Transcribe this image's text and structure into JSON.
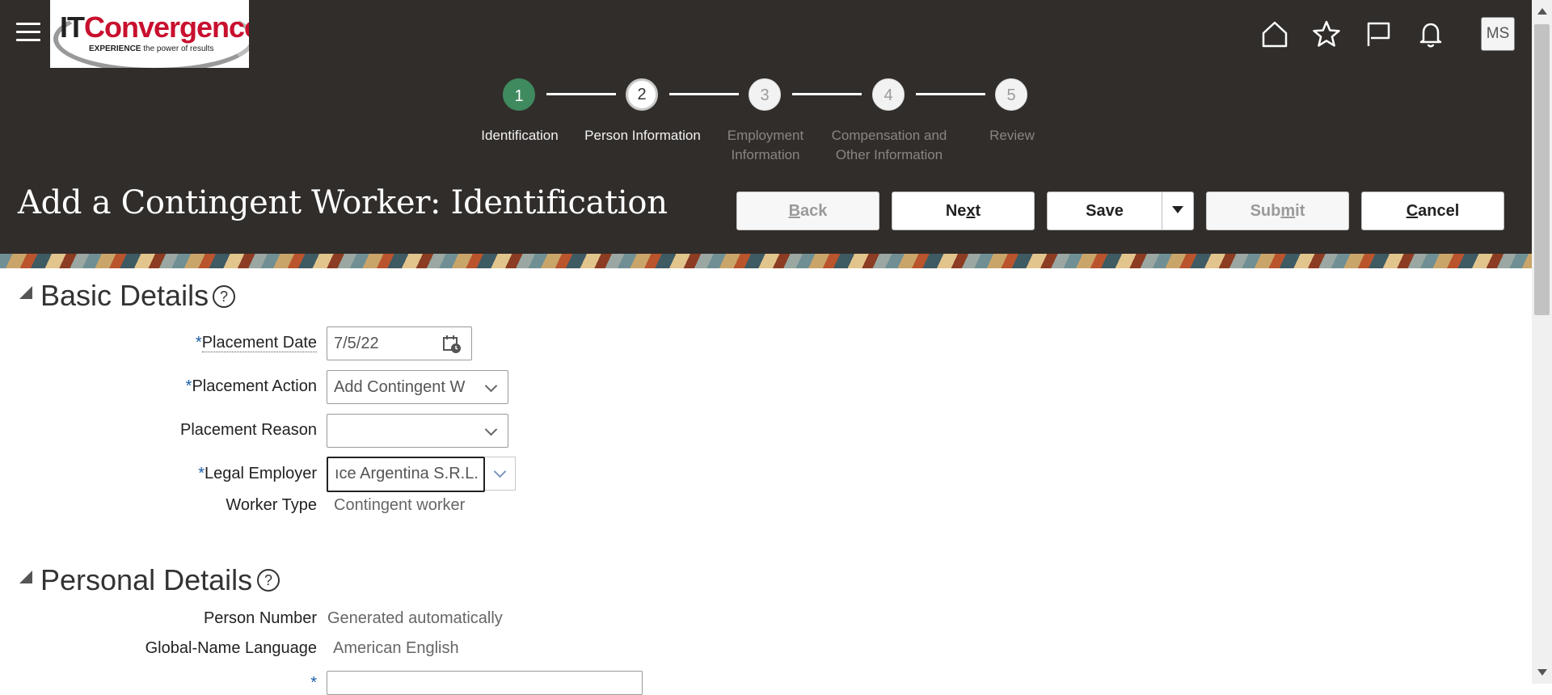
{
  "header": {
    "logo": {
      "it": "IT",
      "convergence": "Convergence",
      "tagline_bold": "EXPERIENCE",
      "tagline_rest": " the power of results"
    },
    "user_initials": "MS",
    "icons": [
      "menu-icon",
      "home-icon",
      "star-icon",
      "flag-icon",
      "bell-icon"
    ]
  },
  "train": {
    "steps": [
      {
        "number": "1",
        "label": "Identification",
        "state": "done"
      },
      {
        "number": "2",
        "label": "Person Information",
        "state": "current"
      },
      {
        "number": "3",
        "label": "Employment\nInformation",
        "state": "future"
      },
      {
        "number": "4",
        "label": "Compensation and\nOther Information",
        "state": "future"
      },
      {
        "number": "5",
        "label": "Review",
        "state": "future"
      }
    ]
  },
  "page": {
    "title": "Add a Contingent Worker: Identification",
    "buttons": {
      "back": {
        "pre": "",
        "key": "B",
        "post": "ack"
      },
      "next": {
        "pre": "Ne",
        "key": "x",
        "post": "t"
      },
      "save": "Save",
      "submit": {
        "pre": "Sub",
        "key": "m",
        "post": "it"
      },
      "cancel": {
        "pre": "",
        "key": "C",
        "post": "ancel"
      }
    }
  },
  "basic_details": {
    "title": "Basic Details",
    "placement_date": {
      "label": "Placement Date",
      "value": "7/5/22",
      "required": "*"
    },
    "placement_action": {
      "label": "Placement Action",
      "value": "Add Contingent W",
      "required": "*"
    },
    "placement_reason": {
      "label": "Placement Reason",
      "value": ""
    },
    "legal_employer": {
      "label": "Legal Employer",
      "value": "ıce Argentina S.R.L.",
      "required": "*"
    },
    "worker_type": {
      "label": "Worker Type",
      "value": "Contingent worker"
    }
  },
  "personal_details": {
    "title": "Personal Details",
    "person_number": {
      "label": "Person Number",
      "value": "Generated automatically"
    },
    "global_name_language": {
      "label": "Global-Name Language",
      "value": "American English"
    },
    "last_name": {
      "required": "*"
    }
  },
  "help_glyph": "?"
}
